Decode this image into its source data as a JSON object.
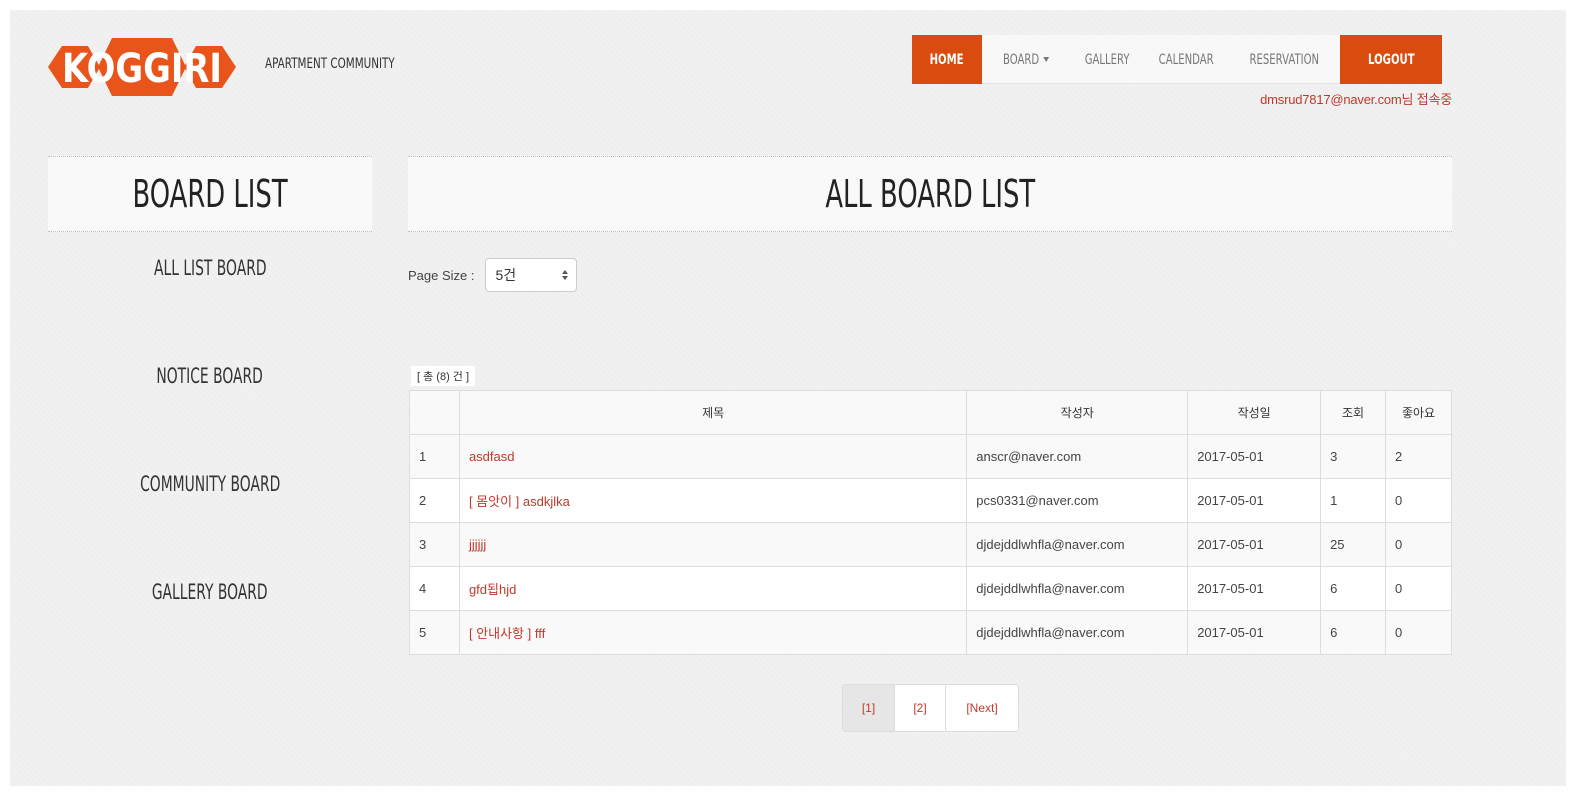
{
  "brand": {
    "logo_text": "KOGGIRI",
    "tagline": "APARTMENT COMMUNITY",
    "color": "#e8541a"
  },
  "nav": {
    "home": "HOME",
    "board": "BOARD",
    "gallery": "GALLERY",
    "calendar": "CALENDAR",
    "reservation": "RESERVATION",
    "logout": "LOGOUT",
    "active_color": "#d94b0e"
  },
  "user_status": "dmsrud7817@naver.com님 접속중",
  "sidebar": {
    "title": "BOARD LIST",
    "items": [
      {
        "label": "ALL LIST BOARD"
      },
      {
        "label": "NOTICE BOARD"
      },
      {
        "label": "COMMUNITY BOARD"
      },
      {
        "label": "GALLERY BOARD"
      }
    ]
  },
  "main": {
    "title": "ALL BOARD LIST",
    "page_size_label": "Page Size :",
    "page_size_value": "5건",
    "total_count": "[ 총 (8) 건 ]",
    "table": {
      "headers": [
        "",
        "제목",
        "작성자",
        "작성일",
        "조회",
        "좋아요"
      ],
      "rows": [
        {
          "no": "1",
          "title": "asdfasd",
          "writer": "anscr@naver.com",
          "date": "2017-05-01",
          "views": "3",
          "likes": "2"
        },
        {
          "no": "2",
          "title": "[ 몸앗이 ] asdkjlka",
          "writer": "pcs0331@naver.com",
          "date": "2017-05-01",
          "views": "1",
          "likes": "0"
        },
        {
          "no": "3",
          "title": "jjjjjj",
          "writer": "djdejddlwhfla@naver.com",
          "date": "2017-05-01",
          "views": "25",
          "likes": "0"
        },
        {
          "no": "4",
          "title": "gfd됩hjd",
          "writer": "djdejddlwhfla@naver.com",
          "date": "2017-05-01",
          "views": "6",
          "likes": "0"
        },
        {
          "no": "5",
          "title": "[ 안내사항 ] fff",
          "writer": "djdejddlwhfla@naver.com",
          "date": "2017-05-01",
          "views": "6",
          "likes": "0"
        }
      ]
    },
    "pagination": {
      "page1": "[1]",
      "page2": "[2]",
      "next": "[Next]"
    }
  }
}
